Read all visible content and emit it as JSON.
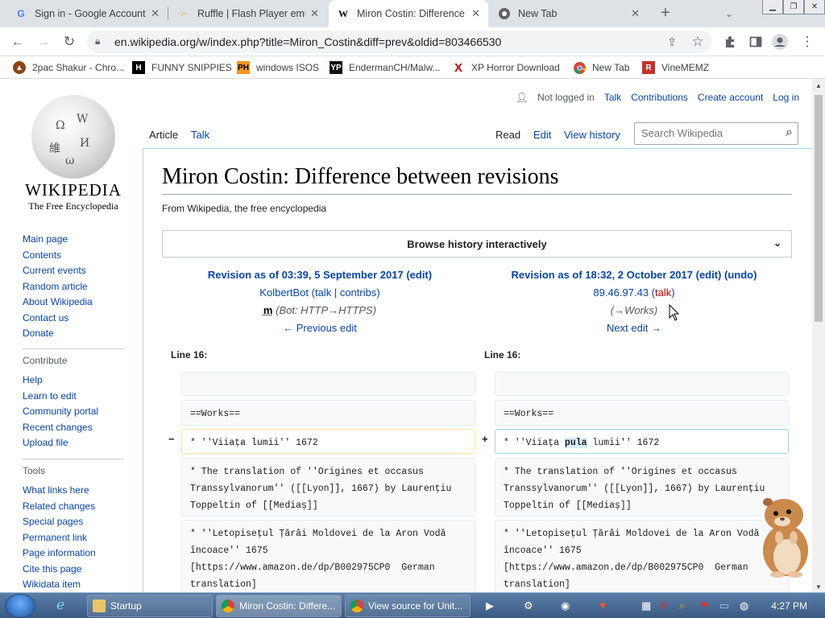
{
  "tabs": [
    {
      "title": "Sign in - Google Account",
      "icon": "google-icon"
    },
    {
      "title": "Ruffle | Flash Player emul",
      "icon": "ruffle-icon"
    },
    {
      "title": "Miron Costin: Difference",
      "icon": "wikipedia-icon"
    },
    {
      "title": "New Tab",
      "icon": "chrome-icon"
    }
  ],
  "address": {
    "url": "en.wikipedia.org/w/index.php?title=Miron_Costin&diff=prev&oldid=803466530"
  },
  "bookmarks": [
    {
      "label": "2pac Shakur - Chro...",
      "icon": "2pac-icon",
      "color": "#8b4513"
    },
    {
      "label": "FUNNY SNIPPIES",
      "icon": "funny-icon",
      "color": "#000000"
    },
    {
      "label": "windows ISOS",
      "icon": "ph-icon",
      "color": "#f7971d"
    },
    {
      "label": "EndermanCH/Malw...",
      "icon": "yp-icon",
      "color": "#111111"
    },
    {
      "label": "XP Horror Download",
      "icon": "x-icon",
      "color": "#cc0000"
    },
    {
      "label": "New Tab",
      "icon": "chrome-icon",
      "color": "#4285f4"
    },
    {
      "label": "VineMEMZ",
      "icon": "r-icon",
      "color": "#c4302b"
    }
  ],
  "wiki": {
    "wordmark": "WIKIPEDIA",
    "tagline": "The Free Encyclopedia",
    "nav_main": [
      "Main page",
      "Contents",
      "Current events",
      "Random article",
      "About Wikipedia",
      "Contact us",
      "Donate"
    ],
    "contribute_heading": "Contribute",
    "nav_contribute": [
      "Help",
      "Learn to edit",
      "Community portal",
      "Recent changes",
      "Upload file"
    ],
    "tools_heading": "Tools",
    "nav_tools": [
      "What links here",
      "Related changes",
      "Special pages",
      "Permanent link",
      "Page information",
      "Cite this page",
      "Wikidata item"
    ],
    "personal": {
      "not_logged": "Not logged in",
      "talk": "Talk",
      "contributions": "Contributions",
      "create": "Create account",
      "login": "Log in"
    },
    "tabs": {
      "article": "Article",
      "talk": "Talk",
      "read": "Read",
      "edit": "Edit",
      "history": "View history"
    },
    "search_placeholder": "Search Wikipedia",
    "title": "Miron Costin: Difference between revisions",
    "sitesub": "From Wikipedia, the free encyclopedia",
    "browse": "Browse history interactively"
  },
  "diff": {
    "left": {
      "revision": "Revision as of 03:39, 5 September 2017",
      "edit": "(edit)",
      "user": "KolbertBot",
      "talk": "talk",
      "contribs": "contribs",
      "minor": "m",
      "summary": "(Bot: HTTP→HTTPS)",
      "nav": "← Previous edit",
      "line": "Line 16:"
    },
    "right": {
      "revision": "Revision as of 18:32, 2 October 2017",
      "edit": "(edit)",
      "undo": "(undo)",
      "user": "89.46.97.43",
      "talk": "talk",
      "summary": "(→Works)",
      "nav": "Next edit →",
      "line": "Line 16:"
    },
    "works": "==Works==",
    "removed_line": "* ''Viiața lumii'' 1672",
    "added_before": "* ''Viiața ",
    "added_word": "pula",
    "added_after": " lumii'' 1672",
    "translation": "* The translation of ''Origines et occasus\nTranssylvanorum'' ([[Lyon]], 1667) by Laurențiu\nToppeltin of [[Mediaș]]",
    "letopiset": "* ''Letopisețul Țărâi Moldovei de la Aron Vodă\nîncoace'' 1675\n[https://www.amazon.de/dp/B002975CP0  German\ntranslation]",
    "minus": "−",
    "plus": "+"
  },
  "taskbar": {
    "items": [
      {
        "label": "Startup",
        "icon": "folder-icon"
      },
      {
        "label": "Miron Costin: Differe...",
        "icon": "chrome-icon"
      },
      {
        "label": "View source for Unit...",
        "icon": "chrome-icon"
      }
    ],
    "clock": "4:27 PM"
  }
}
